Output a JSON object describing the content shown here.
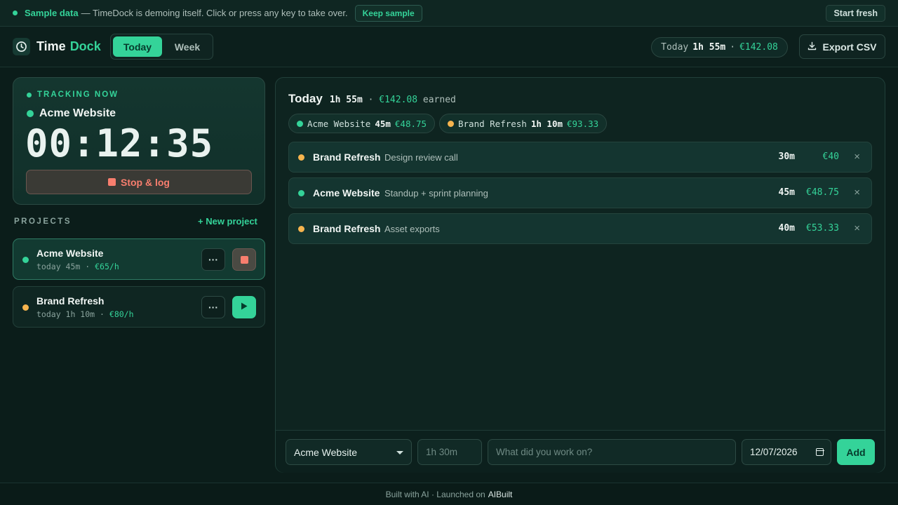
{
  "banner": {
    "strong": "Sample data",
    "text": "— TimeDock is demoing itself. Click or press any key to take over.",
    "keep_label": "Keep sample",
    "fresh_label": "Start fresh"
  },
  "header": {
    "logo_main": "Time",
    "logo_accent": "Dock",
    "tabs": [
      "Today",
      "Week"
    ],
    "summary_label": "Today",
    "summary_time": "1h 55m",
    "summary_sep": "·",
    "summary_amount": "€142.08",
    "export_label": "Export CSV"
  },
  "tracking": {
    "label": "TRACKING NOW",
    "project": "Acme Website",
    "timer": "00:12:35",
    "stop_label": "Stop & log"
  },
  "projects": {
    "heading": "PROJECTS",
    "new_label": "+ New project",
    "items": [
      {
        "name": "Acme Website",
        "today": "today 45m",
        "sep": "·",
        "rate": "€65/h",
        "color": "#34d399"
      },
      {
        "name": "Brand Refresh",
        "today": "today 1h 10m",
        "sep": "·",
        "rate": "€80/h",
        "color": "#f6b44e"
      }
    ]
  },
  "main": {
    "title": "Today",
    "total": "1h 55m",
    "sep": "·",
    "earned_amount": "€142.08",
    "earned_label": "earned",
    "chips": [
      {
        "name": "Acme Website",
        "time": "45m",
        "amount": "€48.75",
        "color": "#34d399"
      },
      {
        "name": "Brand Refresh",
        "time": "1h 10m",
        "amount": "€93.33",
        "color": "#f6b44e"
      }
    ],
    "entries": [
      {
        "project": "Brand Refresh",
        "desc": "Design review call",
        "duration": "30m",
        "amount": "€40",
        "color": "#f6b44e"
      },
      {
        "project": "Acme Website",
        "desc": "Standup + sprint planning",
        "duration": "45m",
        "amount": "€48.75",
        "color": "#34d399"
      },
      {
        "project": "Brand Refresh",
        "desc": "Asset exports",
        "duration": "40m",
        "amount": "€53.33",
        "color": "#f6b44e"
      }
    ],
    "form": {
      "project_value": "Acme Website",
      "duration_placeholder": "1h 30m",
      "desc_placeholder": "What did you work on?",
      "date_value": "12/07/2026",
      "add_label": "Add"
    }
  },
  "footer": {
    "text": "Built with AI · Launched on",
    "brand": "AIBuilt"
  }
}
